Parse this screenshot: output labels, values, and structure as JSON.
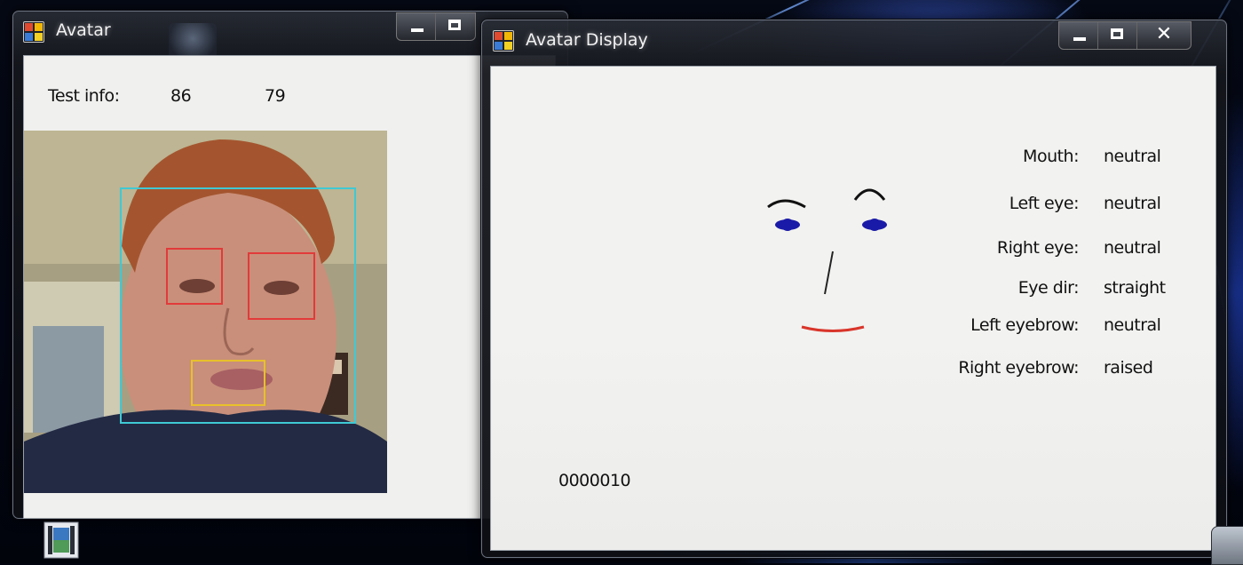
{
  "desktop": {
    "taskbar_icon": "video-file-icon"
  },
  "avatar_window": {
    "title": "Avatar",
    "icon": "windows-form-app-icon",
    "test_info_label": "Test info:",
    "test_info_value_1": "86",
    "test_info_value_2": "79",
    "camera": {
      "face_box_color": "#3fc9d4",
      "eye_box_color": "#e23a3a",
      "mouth_box_color": "#e8c12a"
    }
  },
  "display_window": {
    "title": "Avatar Display",
    "icon": "windows-form-app-icon",
    "status_code": "0000010",
    "features": [
      {
        "label": "Mouth:",
        "value": "neutral"
      },
      {
        "label": "Left eye:",
        "value": "neutral"
      },
      {
        "label": "Right eye:",
        "value": "neutral"
      },
      {
        "label": "Eye dir:",
        "value": "straight"
      },
      {
        "label": "Left eyebrow:",
        "value": "neutral"
      },
      {
        "label": "Right eyebrow:",
        "value": "raised"
      }
    ],
    "avatar_colors": {
      "eye": "#1a1aa8",
      "brow": "#111111",
      "nose": "#222222",
      "mouth": "#d9352a"
    }
  }
}
